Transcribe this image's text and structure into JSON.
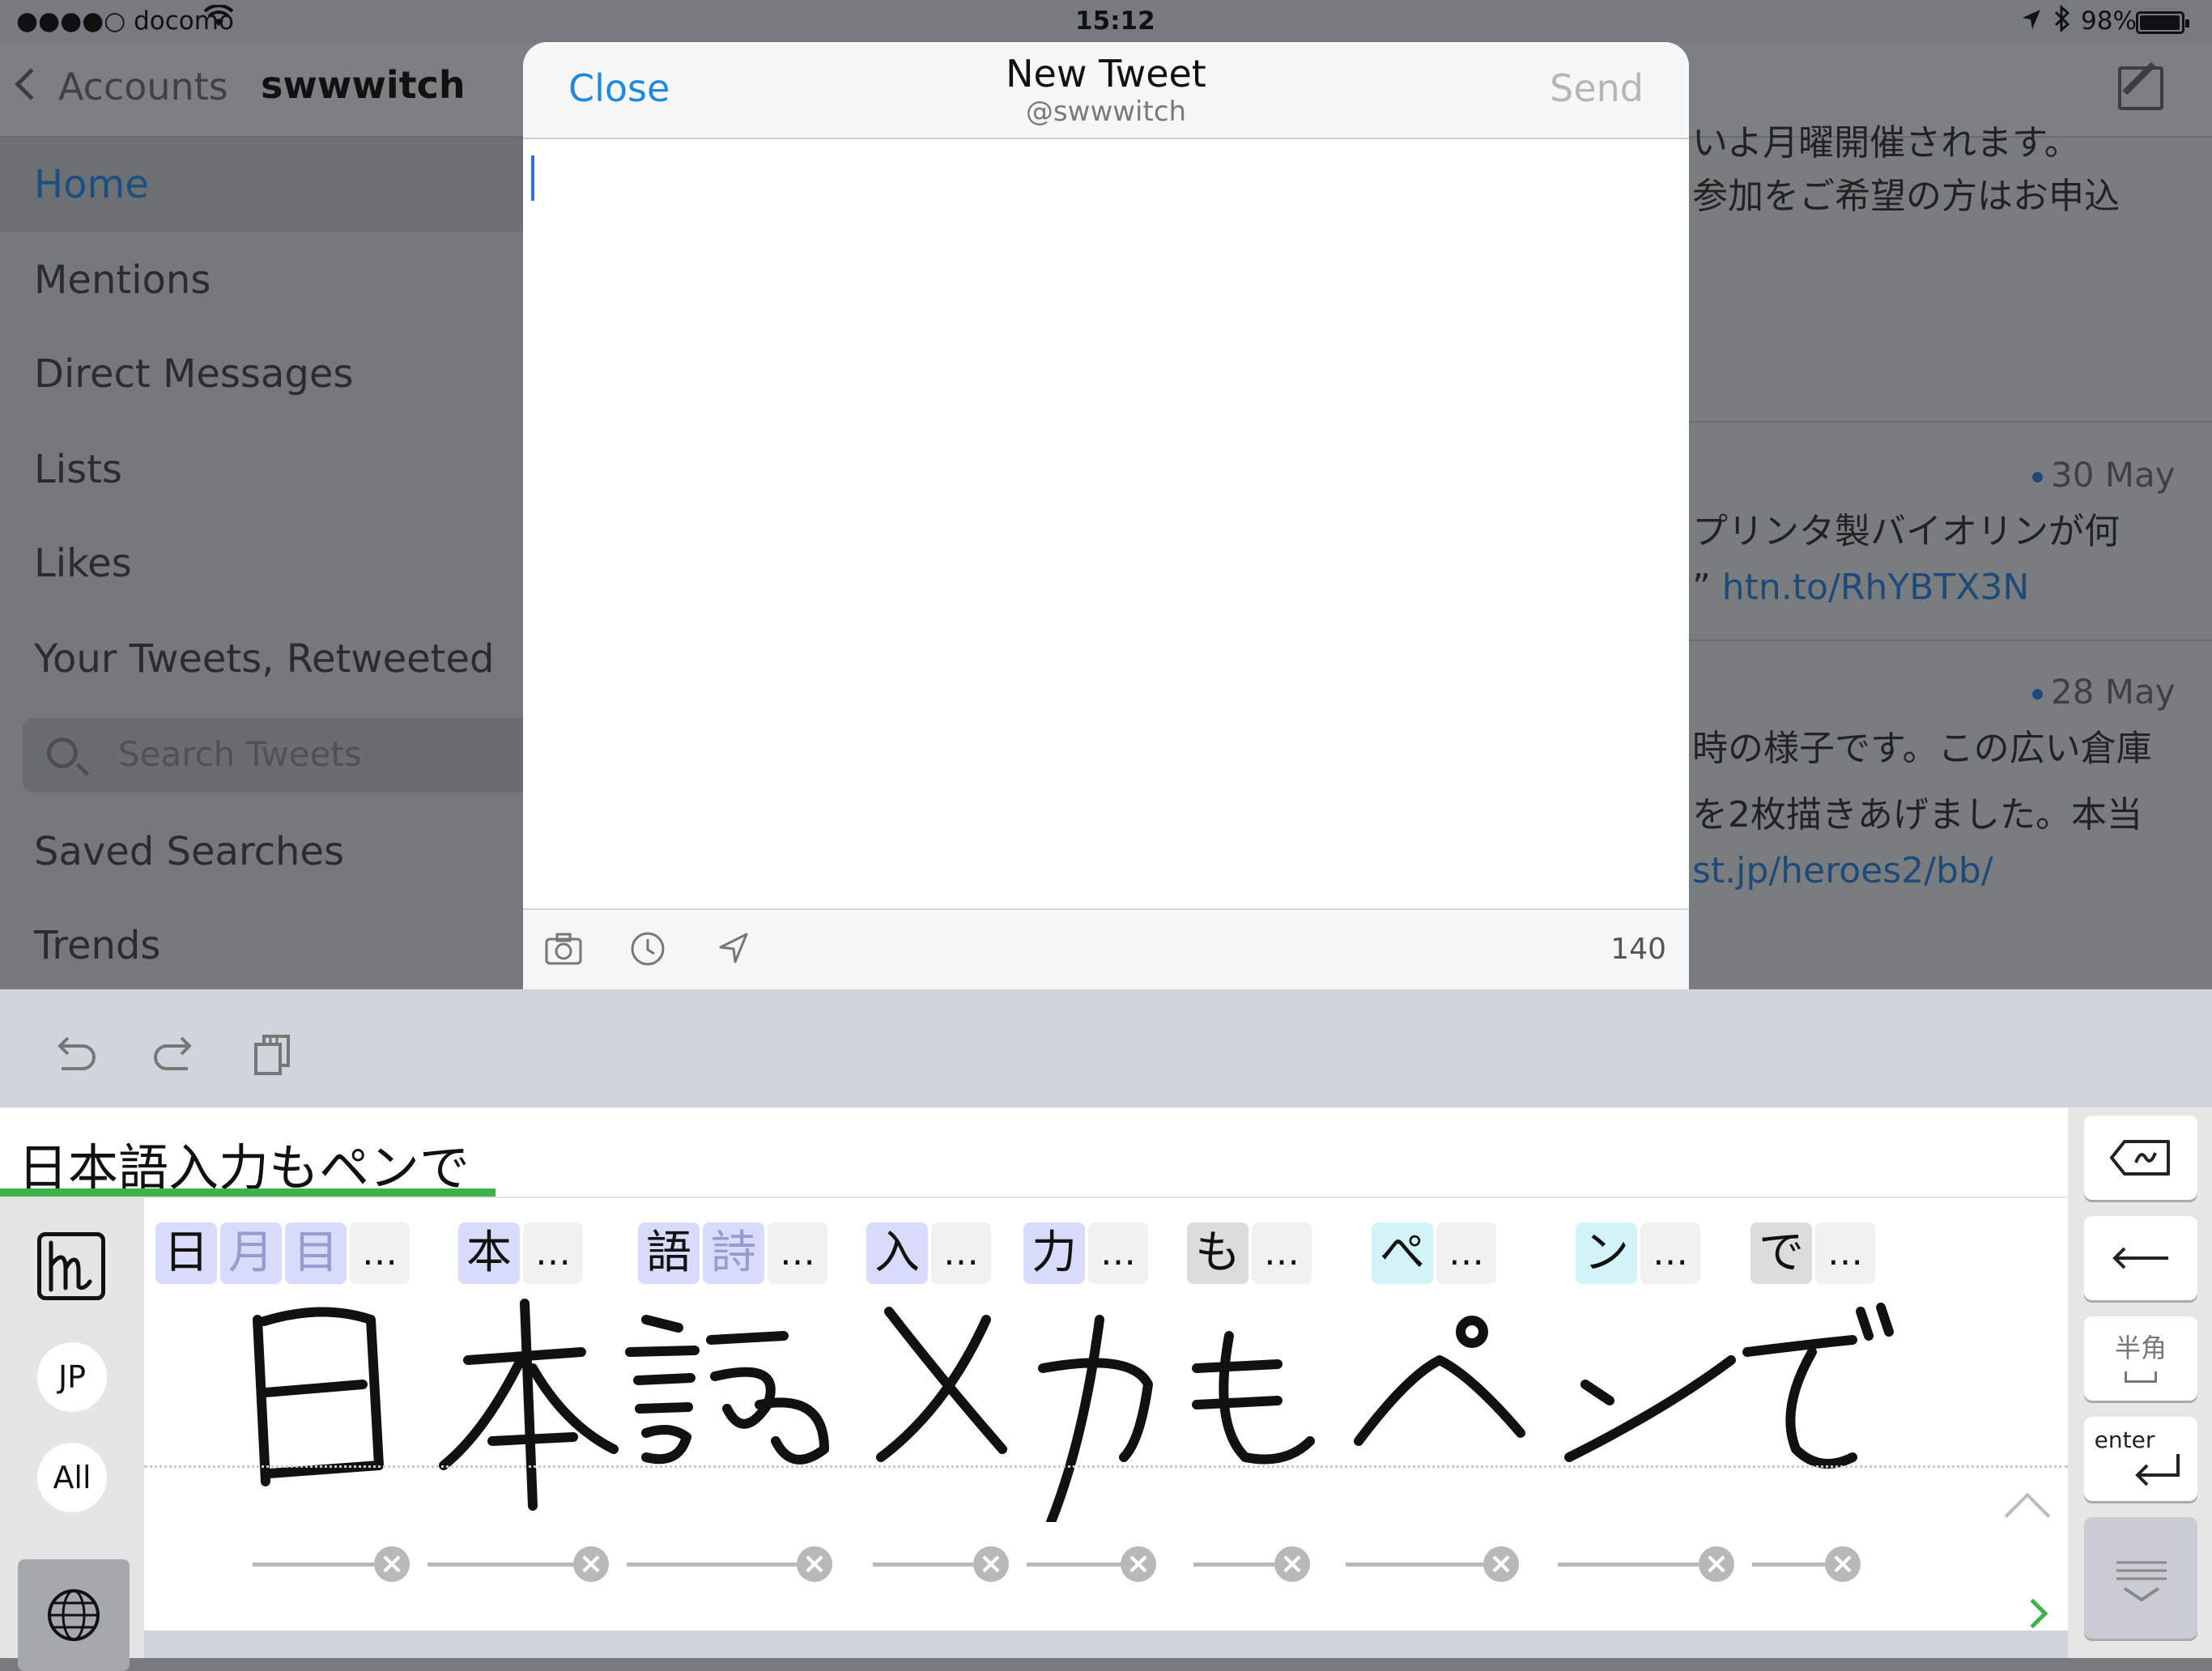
{
  "status_bar": {
    "carrier": "●●●●○ docomo",
    "time": "15:12",
    "battery_text": "98%",
    "battery_level": 0.98
  },
  "sidebar": {
    "back_label": "Accounts",
    "account_name": "swwwitch",
    "items": [
      {
        "label": "Home",
        "active": true
      },
      {
        "label": "Mentions"
      },
      {
        "label": "Direct Messages"
      },
      {
        "label": "Lists"
      },
      {
        "label": "Likes"
      },
      {
        "label": "Your Tweets, Retweeted"
      },
      {
        "label": "Saved Searches"
      },
      {
        "label": "Trends"
      }
    ],
    "search_placeholder": "Search Tweets"
  },
  "timeline": {
    "lines": [
      {
        "text": "いよ月曜開催されます。"
      },
      {
        "text": "参加をご希望の方はお申込"
      },
      {
        "text": "プリンタ製バイオリンが何"
      },
      {
        "prefix": "” ",
        "link": "htn.to/RhYBTX3N"
      },
      {
        "text": "時の様子です。この広い倉庫"
      },
      {
        "text": "を2枚描きあげました。本当"
      },
      {
        "link": "st.jp/heroes2/bb/"
      }
    ],
    "dates": [
      "30 May",
      "28 May"
    ]
  },
  "compose": {
    "close_label": "Close",
    "title": "New Tweet",
    "subtitle": "@swwwitch",
    "send_label": "Send",
    "char_count": "140"
  },
  "keyboard": {
    "composed_text": "日本語入力もペンで",
    "mode_jp": "JP",
    "mode_all": "All",
    "candidates": [
      {
        "chars": [
          "日",
          "月",
          "目"
        ],
        "more": "…"
      },
      {
        "chars": [
          "本"
        ],
        "more": "…"
      },
      {
        "chars": [
          "語",
          "詩"
        ],
        "more": "…"
      },
      {
        "chars": [
          "入"
        ],
        "more": "…"
      },
      {
        "chars": [
          "力"
        ],
        "more": "…"
      },
      {
        "chars": [
          "も"
        ],
        "more": "…"
      },
      {
        "chars": [
          "ぺ"
        ],
        "more": "…"
      },
      {
        "chars": [
          "ン"
        ],
        "more": "…"
      },
      {
        "chars": [
          "で"
        ],
        "more": "…"
      }
    ],
    "handwriting_ink": "日本語入力もペンで",
    "keys": {
      "hankaku": "半角",
      "enter": "enter"
    }
  },
  "colors": {
    "accent_blue": "#1d8ae0",
    "composition_green": "#3bb34a",
    "candidate_blue": "#d8dcfa",
    "candidate_cyan": "#d2f4f8"
  }
}
